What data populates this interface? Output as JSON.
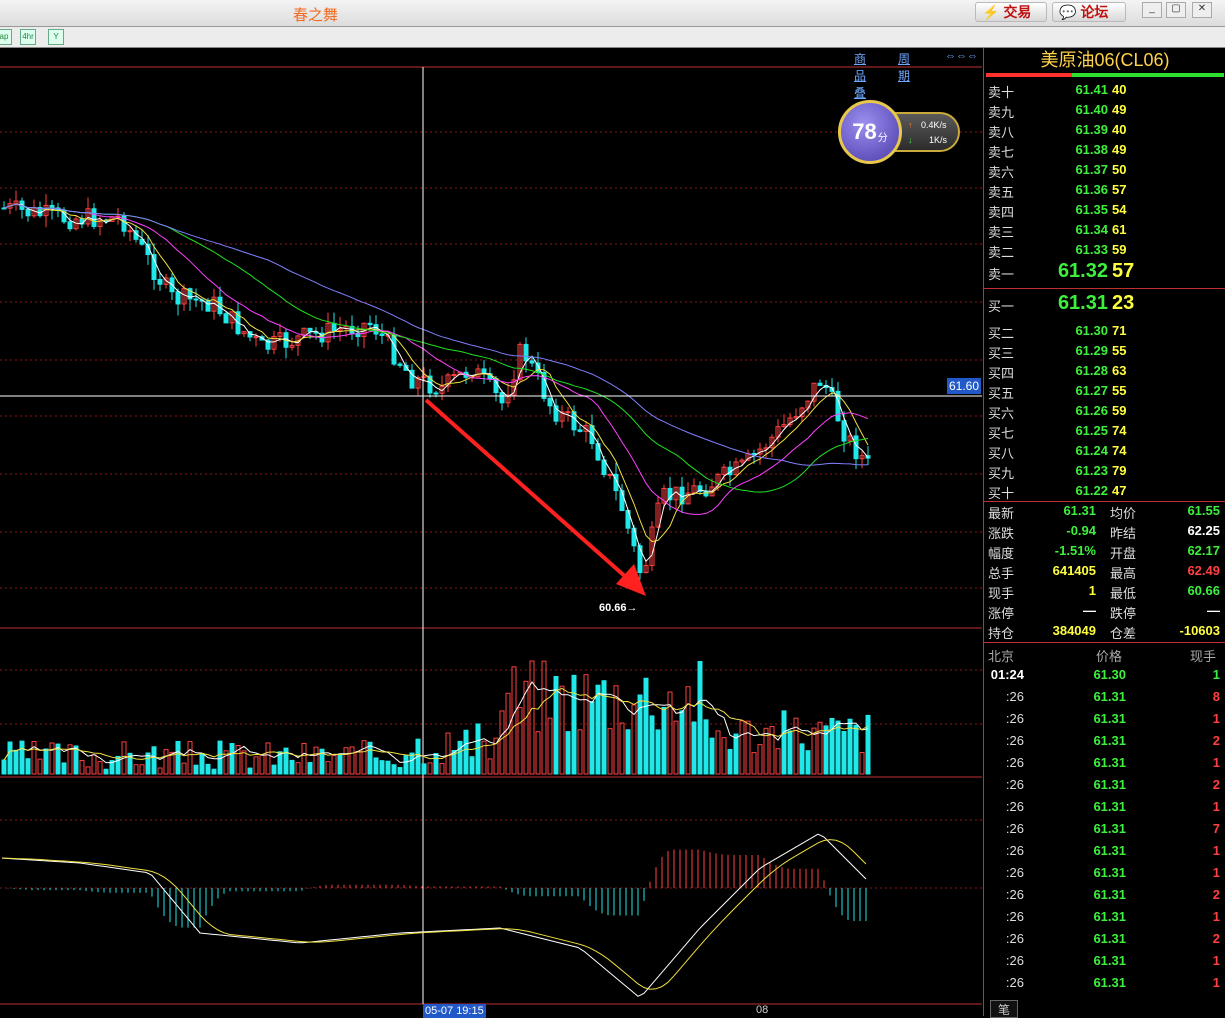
{
  "window": {
    "title": "春之舞",
    "trade_button": "交易",
    "forum_button": "论坛"
  },
  "toolbar": {
    "tab_labels": [
      "ap",
      "4hr",
      "Y"
    ]
  },
  "chart": {
    "overlay_link": "商品叠加",
    "period_link": "周期",
    "crosshair_price": "61.60",
    "low_annotation": "60.66→",
    "crosshair_date": "05-07 19:15",
    "date_tick": "08",
    "score": "78",
    "score_unit": "分",
    "upload_speed": "0.4K/s",
    "download_speed": "1K/s",
    "colors": {
      "bull": "#ff4040",
      "bear": "#20e8e8",
      "ma5": "#ffffff",
      "ma10": "#f0e040",
      "ma20": "#ff40ff",
      "ma40": "#20e020",
      "ma60": "#8080ff",
      "grid": "#8a1a1a"
    }
  },
  "chart_data": {
    "type": "candlestick",
    "subcharts": [
      "price",
      "volume",
      "macd"
    ],
    "low_price": 60.66,
    "crosshair_price": 61.6
  },
  "quote": {
    "symbol": "美原油06(CL06)",
    "asks": [
      {
        "label": "卖十",
        "price": "61.41",
        "vol": "40"
      },
      {
        "label": "卖九",
        "price": "61.40",
        "vol": "49"
      },
      {
        "label": "卖八",
        "price": "61.39",
        "vol": "40"
      },
      {
        "label": "卖七",
        "price": "61.38",
        "vol": "49"
      },
      {
        "label": "卖六",
        "price": "61.37",
        "vol": "50"
      },
      {
        "label": "卖五",
        "price": "61.36",
        "vol": "57"
      },
      {
        "label": "卖四",
        "price": "61.35",
        "vol": "54"
      },
      {
        "label": "卖三",
        "price": "61.34",
        "vol": "61"
      },
      {
        "label": "卖二",
        "price": "61.33",
        "vol": "59"
      },
      {
        "label": "卖一",
        "price": "61.32",
        "vol": "57"
      }
    ],
    "bids": [
      {
        "label": "买一",
        "price": "61.31",
        "vol": "23"
      },
      {
        "label": "买二",
        "price": "61.30",
        "vol": "71"
      },
      {
        "label": "买三",
        "price": "61.29",
        "vol": "55"
      },
      {
        "label": "买四",
        "price": "61.28",
        "vol": "63"
      },
      {
        "label": "买五",
        "price": "61.27",
        "vol": "55"
      },
      {
        "label": "买六",
        "price": "61.26",
        "vol": "59"
      },
      {
        "label": "买七",
        "price": "61.25",
        "vol": "74"
      },
      {
        "label": "买八",
        "price": "61.24",
        "vol": "74"
      },
      {
        "label": "买九",
        "price": "61.23",
        "vol": "79"
      },
      {
        "label": "买十",
        "price": "61.22",
        "vol": "47"
      }
    ],
    "stats": [
      {
        "l": "最新",
        "lv": "61.31",
        "lc": "green",
        "r": "均价",
        "rv": "61.55",
        "rc": "green"
      },
      {
        "l": "涨跌",
        "lv": "-0.94",
        "lc": "green",
        "r": "昨结",
        "rv": "62.25",
        "rc": "white"
      },
      {
        "l": "幅度",
        "lv": "-1.51%",
        "lc": "green",
        "r": "开盘",
        "rv": "62.17",
        "rc": "green"
      },
      {
        "l": "总手",
        "lv": "641405",
        "lc": "yellow",
        "r": "最高",
        "rv": "62.49",
        "rc": "red"
      },
      {
        "l": "现手",
        "lv": "1",
        "lc": "yellow",
        "r": "最低",
        "rv": "60.66",
        "rc": "green"
      },
      {
        "l": "涨停",
        "lv": "—",
        "lc": "white",
        "r": "跌停",
        "rv": "—",
        "rc": "white"
      },
      {
        "l": "持仓",
        "lv": "384049",
        "lc": "yellow",
        "r": "仓差",
        "rv": "-10603",
        "rc": "yellow"
      }
    ],
    "ticks_header": {
      "time": "北京",
      "price": "价格",
      "vol": "现手"
    },
    "ticks": [
      {
        "time": "01:24",
        "price": "61.30",
        "vol": "1",
        "vc": "green"
      },
      {
        "time": ":26",
        "price": "61.31",
        "vol": "8",
        "vc": "red"
      },
      {
        "time": ":26",
        "price": "61.31",
        "vol": "1",
        "vc": "red"
      },
      {
        "time": ":26",
        "price": "61.31",
        "vol": "2",
        "vc": "red"
      },
      {
        "time": ":26",
        "price": "61.31",
        "vol": "1",
        "vc": "red"
      },
      {
        "time": ":26",
        "price": "61.31",
        "vol": "2",
        "vc": "red"
      },
      {
        "time": ":26",
        "price": "61.31",
        "vol": "1",
        "vc": "red"
      },
      {
        "time": ":26",
        "price": "61.31",
        "vol": "7",
        "vc": "red"
      },
      {
        "time": ":26",
        "price": "61.31",
        "vol": "1",
        "vc": "red"
      },
      {
        "time": ":26",
        "price": "61.31",
        "vol": "1",
        "vc": "red"
      },
      {
        "time": ":26",
        "price": "61.31",
        "vol": "2",
        "vc": "red"
      },
      {
        "time": ":26",
        "price": "61.31",
        "vol": "1",
        "vc": "red"
      },
      {
        "time": ":26",
        "price": "61.31",
        "vol": "2",
        "vc": "red"
      },
      {
        "time": ":26",
        "price": "61.31",
        "vol": "1",
        "vc": "red"
      },
      {
        "time": ":26",
        "price": "61.31",
        "vol": "1",
        "vc": "red"
      }
    ],
    "bottom_tab": "笔"
  }
}
